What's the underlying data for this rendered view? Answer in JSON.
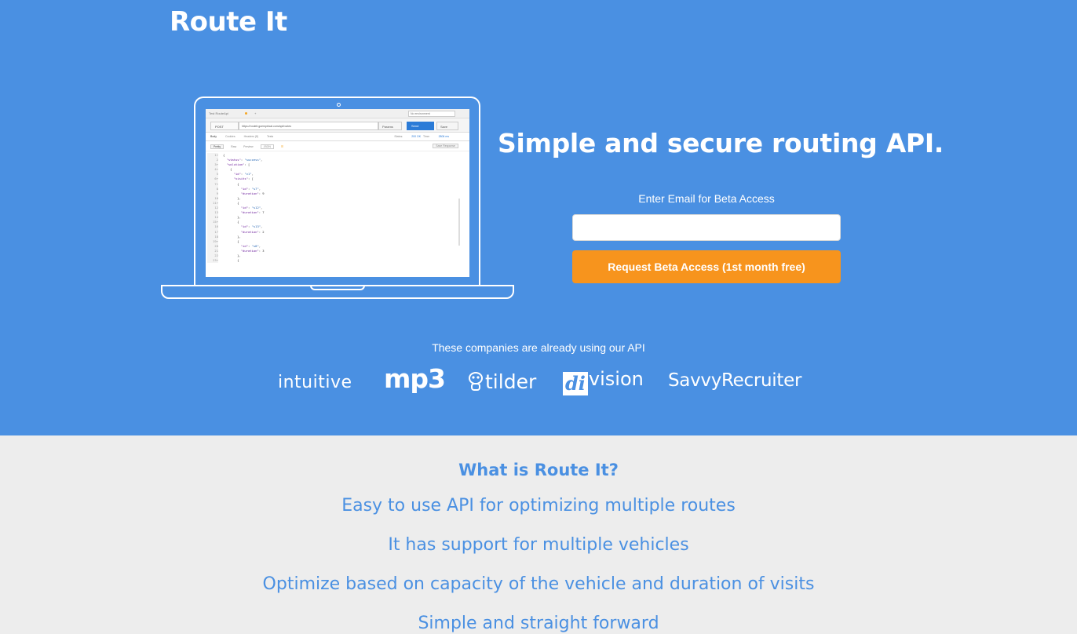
{
  "brand": "Route It",
  "hero": {
    "headline": "Simple and secure routing API.",
    "email_label": "Enter Email for Beta Access",
    "email_value": "",
    "cta_label": "Request Beta Access (1st month free)"
  },
  "mock_screen": {
    "tab_title": "Test RouteApi",
    "tab_plus": "+",
    "environment": "No environment",
    "method": "POST",
    "url": "https://routeit.goempirical.com/api/routes",
    "params": "Params",
    "send": "Send",
    "save": "Save",
    "tabs": [
      "Body",
      "Cookies",
      "Headers (8)",
      "Tests"
    ],
    "status_label": "Status:",
    "status_value": "200 OK",
    "time_label": "Time:",
    "time_value": "2806 ms",
    "views": [
      "Pretty",
      "Raw",
      "Preview"
    ],
    "format": "JSON",
    "save_response": "Save Response"
  },
  "companies": {
    "label": "These companies are already using our API",
    "logos": [
      {
        "name": "intuitive",
        "text": "intuitive"
      },
      {
        "name": "mp3",
        "text": "mp3"
      },
      {
        "name": "tilder",
        "text": "tilder"
      },
      {
        "name": "division",
        "box": "di",
        "text": "vision"
      },
      {
        "name": "savvyrecruiter",
        "text": "SavvyRecruiter"
      }
    ]
  },
  "about": {
    "title": "What is Route It?",
    "features": [
      "Easy to use API for optimizing multiple routes",
      "It has support for multiple vehicles",
      "Optimize based on capacity of the vehicle and duration of visits",
      "Simple and straight forward"
    ]
  },
  "colors": {
    "hero_bg": "#4a90e2",
    "cta": "#f7941d",
    "page_bg": "#ededed",
    "text_accent": "#4a90e2"
  }
}
